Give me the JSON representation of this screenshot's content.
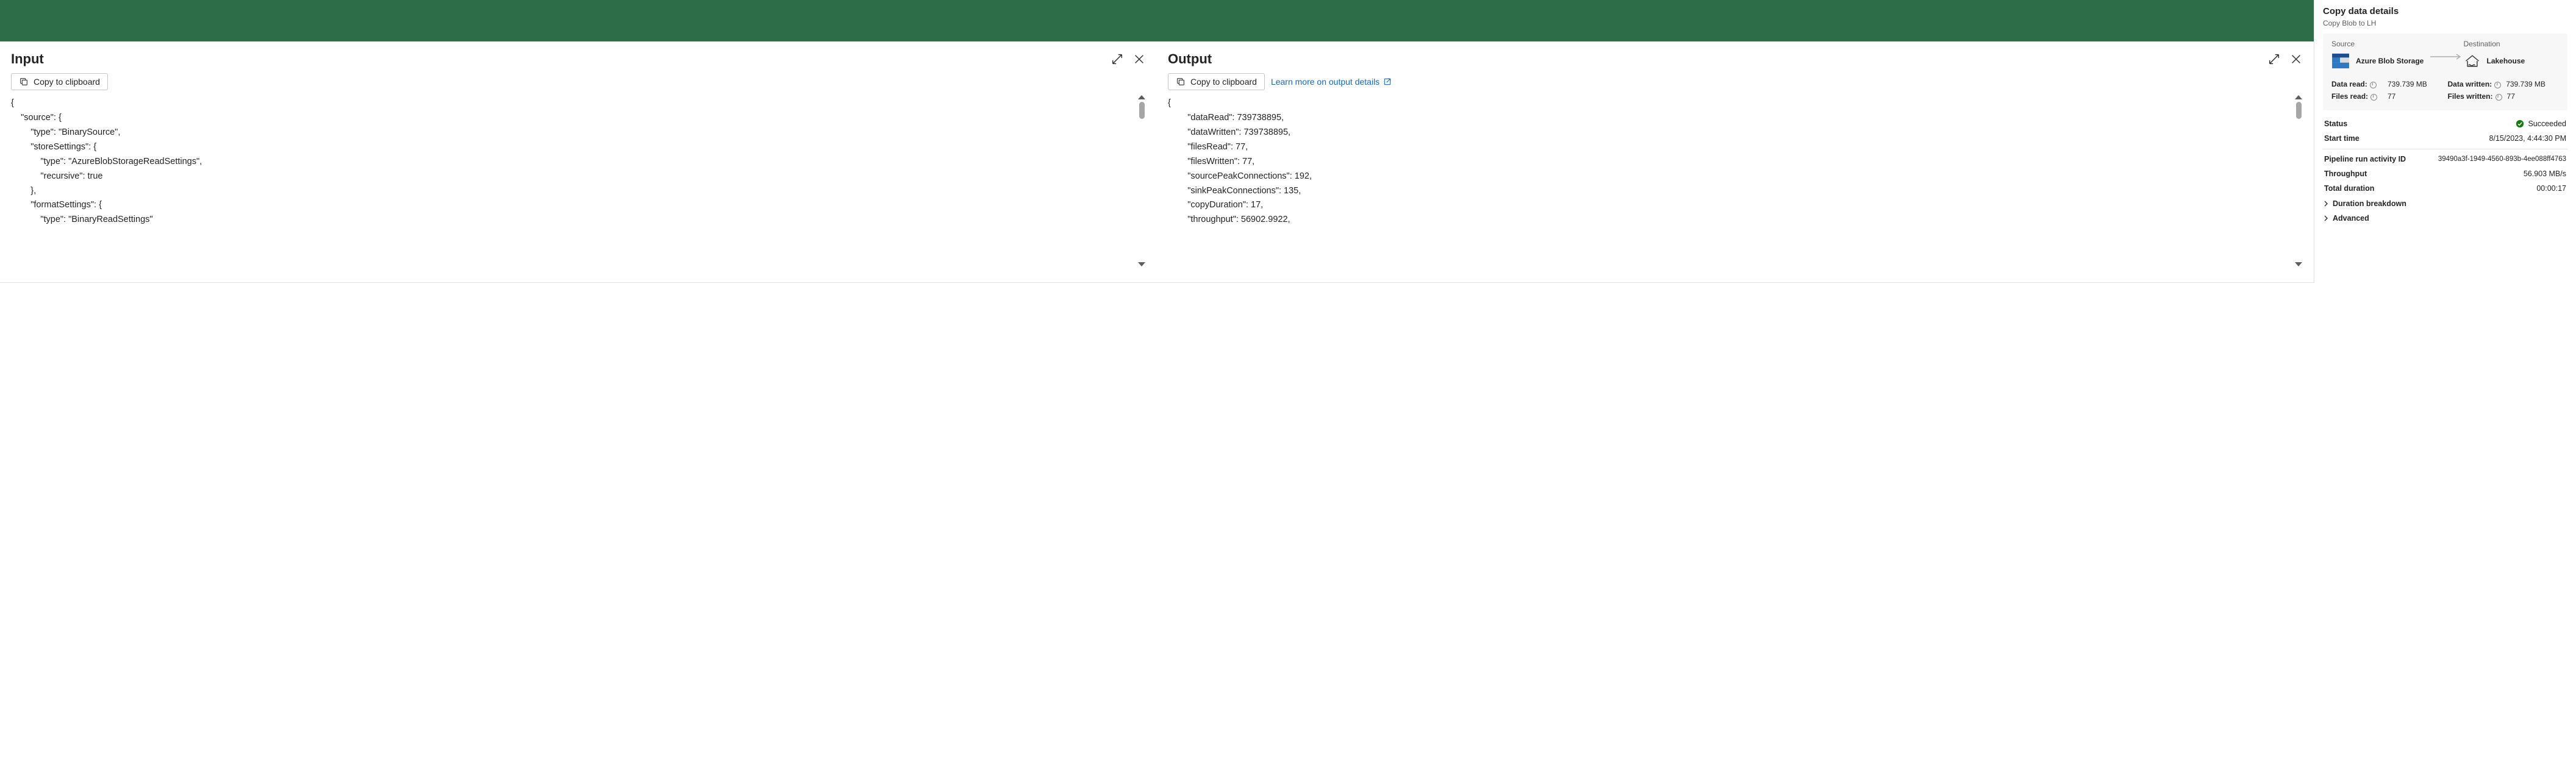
{
  "input_panel": {
    "title": "Input",
    "copy_label": "Copy to clipboard",
    "json_text": "{\n    \"source\": {\n        \"type\": \"BinarySource\",\n        \"storeSettings\": {\n            \"type\": \"AzureBlobStorageReadSettings\",\n            \"recursive\": true\n        },\n        \"formatSettings\": {\n            \"type\": \"BinaryReadSettings\""
  },
  "output_panel": {
    "title": "Output",
    "copy_label": "Copy to clipboard",
    "learn_more_label": "Learn more on output details",
    "json_text": "{\n        \"dataRead\": 739738895,\n        \"dataWritten\": 739738895,\n        \"filesRead\": 77,\n        \"filesWritten\": 77,\n        \"sourcePeakConnections\": 192,\n        \"sinkPeakConnections\": 135,\n        \"copyDuration\": 17,\n        \"throughput\": 56902.9922,"
  },
  "details": {
    "title": "Copy data details",
    "subtitle": "Copy Blob to LH",
    "source_heading": "Source",
    "destination_heading": "Destination",
    "source_name": "Azure Blob Storage",
    "destination_name": "Lakehouse",
    "card_stats": {
      "source": {
        "data_read_label": "Data read:",
        "data_read_value": "739.739 MB",
        "files_read_label": "Files read:",
        "files_read_value": "77"
      },
      "destination": {
        "data_written_label": "Data written:",
        "data_written_value": "739.739 MB",
        "files_written_label": "Files written:",
        "files_written_value": "77"
      }
    },
    "rows": {
      "status_label": "Status",
      "status_value": "Succeeded",
      "start_label": "Start time",
      "start_value": "8/15/2023, 4:44:30 PM",
      "activity_label": "Pipeline run activity ID",
      "activity_value": "39490a3f-1949-4560-893b-4ee088ff4763",
      "throughput_label": "Throughput",
      "throughput_value": "56.903 MB/s",
      "total_dur_label": "Total duration",
      "total_dur_value": "00:00:17"
    },
    "expanders": {
      "duration": "Duration breakdown",
      "advanced": "Advanced"
    }
  }
}
